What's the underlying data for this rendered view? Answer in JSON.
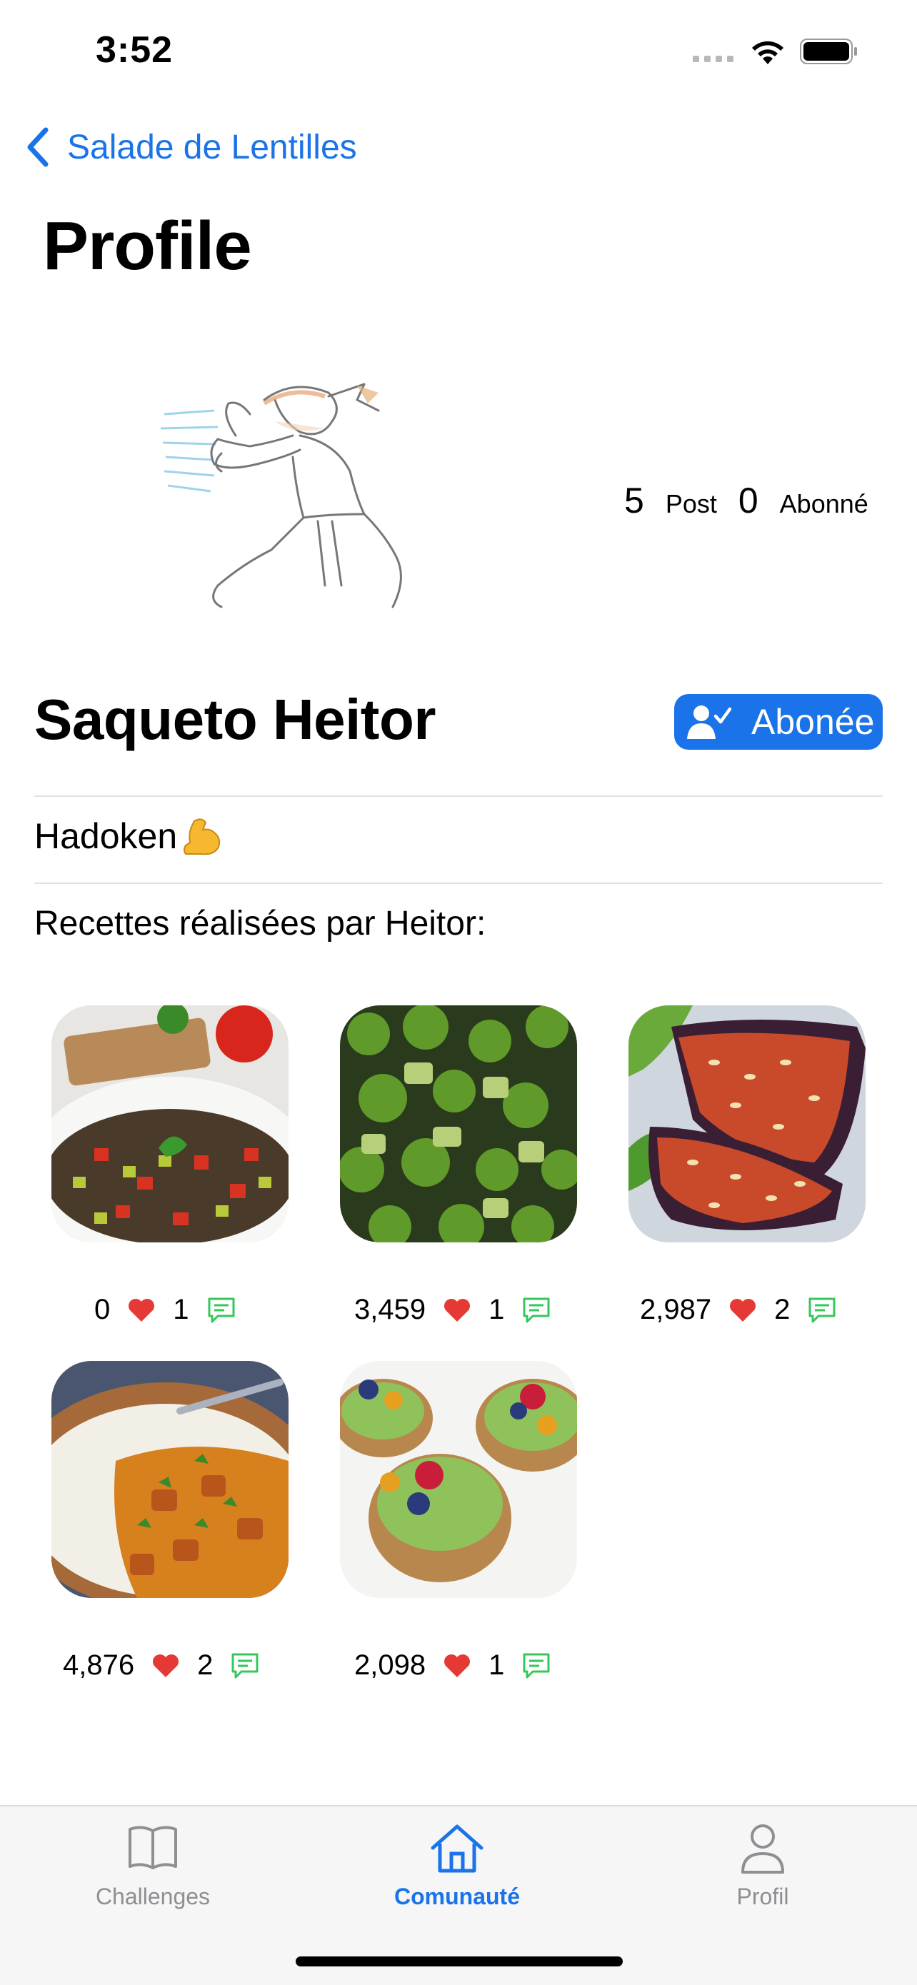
{
  "status_bar": {
    "time": "3:52"
  },
  "nav": {
    "back_label": "Salade de Lentilles",
    "title": "Profile"
  },
  "profile": {
    "posts_count": "5",
    "posts_label": "Post",
    "followers_count": "0",
    "followers_label": "Abonné",
    "name": "Saqueto Heitor",
    "follow_button": "Abonée",
    "bio": "Hadoken",
    "section_title": "Recettes réalisées par Heitor:"
  },
  "recipes": [
    {
      "likes": "0",
      "comments": "1"
    },
    {
      "likes": "3,459",
      "comments": "1"
    },
    {
      "likes": "2,987",
      "comments": "2"
    },
    {
      "likes": "4,876",
      "comments": "2"
    },
    {
      "likes": "2,098",
      "comments": "1"
    }
  ],
  "tabs": [
    {
      "label": "Challenges",
      "icon": "book-icon"
    },
    {
      "label": "Comunauté",
      "icon": "home-icon"
    },
    {
      "label": "Profil",
      "icon": "person-icon"
    }
  ],
  "colors": {
    "accent": "#1a73e8",
    "heart": "#e53935",
    "comment": "#34c759"
  }
}
